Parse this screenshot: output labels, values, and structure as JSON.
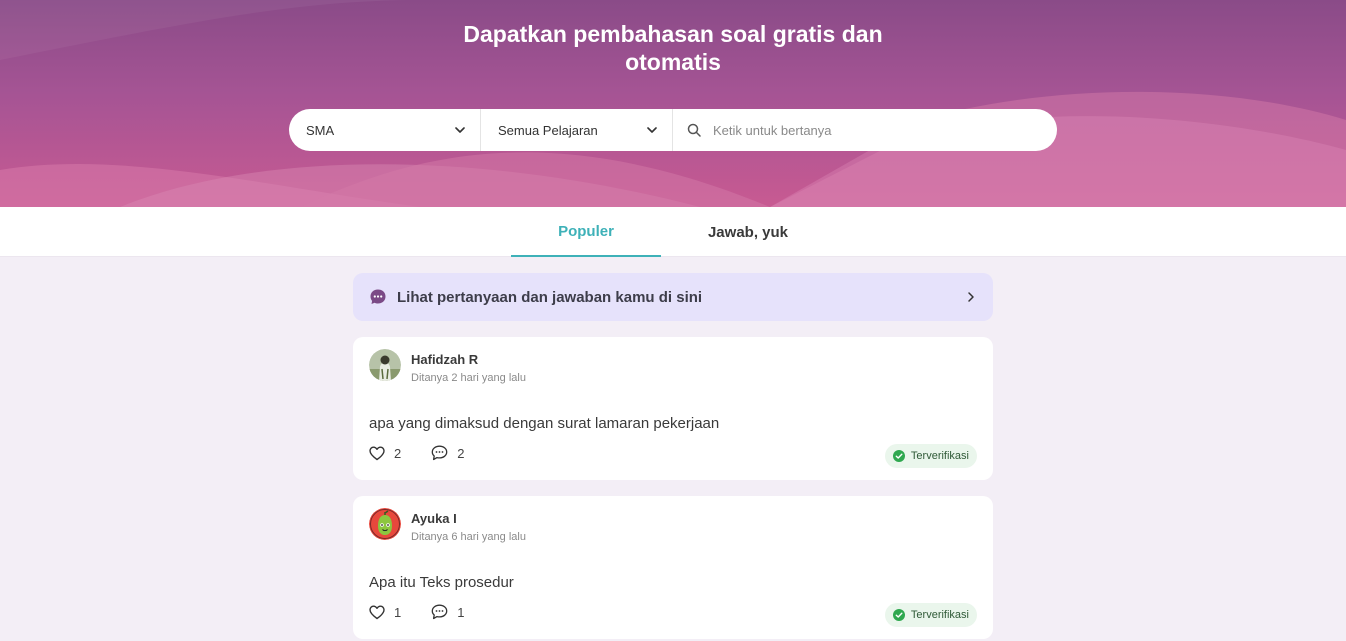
{
  "hero": {
    "title": "Dapatkan pembahasan soal gratis dan otomatis"
  },
  "search": {
    "level_selected": "SMA",
    "subject_selected": "Semua Pelajaran",
    "placeholder": "Ketik untuk bertanya",
    "value": ""
  },
  "tabs": [
    {
      "label": "Populer",
      "active": true
    },
    {
      "label": "Jawab, yuk",
      "active": false
    }
  ],
  "banner": {
    "text": "Lihat pertanyaan dan jawaban kamu di sini",
    "icon": "chat-bubble-icon"
  },
  "questions": [
    {
      "author": "Hafidzah R",
      "time": "Ditanya 2 hari yang lalu",
      "text": "apa yang dimaksud dengan surat lamaran pekerjaan",
      "likes": "2",
      "comments": "2",
      "badge": "Terverifikasi"
    },
    {
      "author": "Ayuka I",
      "time": "Ditanya 6 hari yang lalu",
      "text": "Apa itu Teks prosedur",
      "likes": "1",
      "comments": "1",
      "badge": "Terverifikasi"
    }
  ],
  "colors": {
    "accent": "#3eb1b8",
    "hero_top": "#8a4b88",
    "hero_bottom": "#c85a92",
    "banner_bg": "#e6e2fb",
    "verified_green": "#2fa84f"
  }
}
